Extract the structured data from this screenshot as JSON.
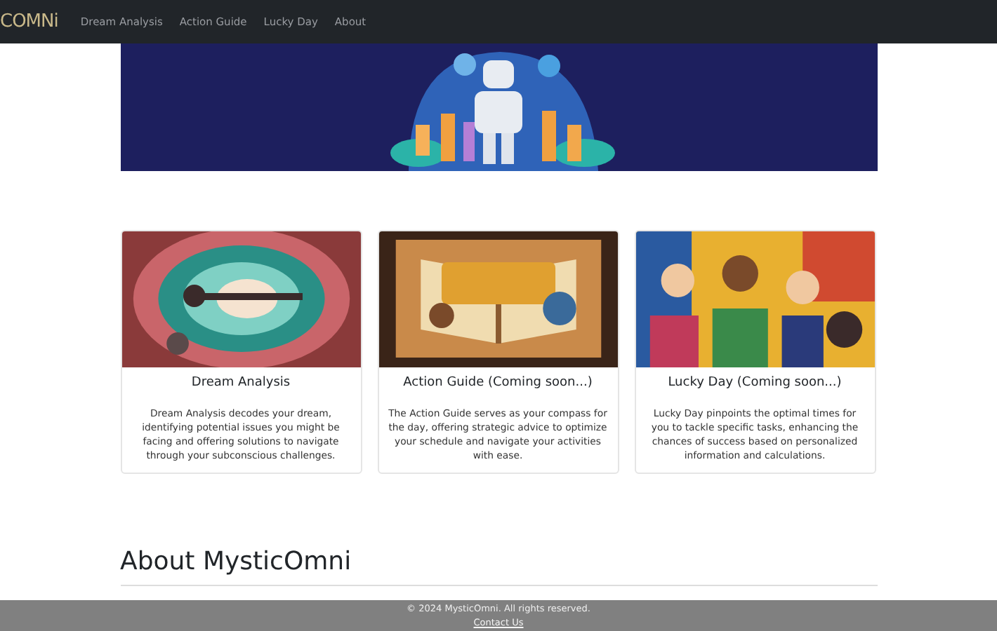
{
  "navbar": {
    "logo": "COMNi",
    "links": [
      {
        "label": "Dream Analysis"
      },
      {
        "label": "Action Guide"
      },
      {
        "label": "Lucky Day"
      },
      {
        "label": "About"
      }
    ]
  },
  "cards": [
    {
      "title": "Dream Analysis",
      "text": "Dream Analysis decodes your dream, identifying potential issues you might be facing and offering solutions to navigate through your subconscious challenges.",
      "kind": "picture"
    },
    {
      "title": "Action Guide (Coming soon...)",
      "text": "The Action Guide serves as your compass for the day, offering strategic advice to optimize your schedule and navigate your activities with ease.",
      "kind": "picture"
    },
    {
      "title": "Lucky Day (Coming soon...)",
      "text": "Lucky Day pinpoints the optimal times for you to tackle specific tasks, enhancing the chances of success based on personalized information and calculations.",
      "kind": "picture"
    }
  ],
  "about": {
    "heading": "About MysticOmni"
  },
  "footer": {
    "copyright": "© 2024 MysticOmni. All rights reserved.",
    "link": "Contact Us"
  }
}
